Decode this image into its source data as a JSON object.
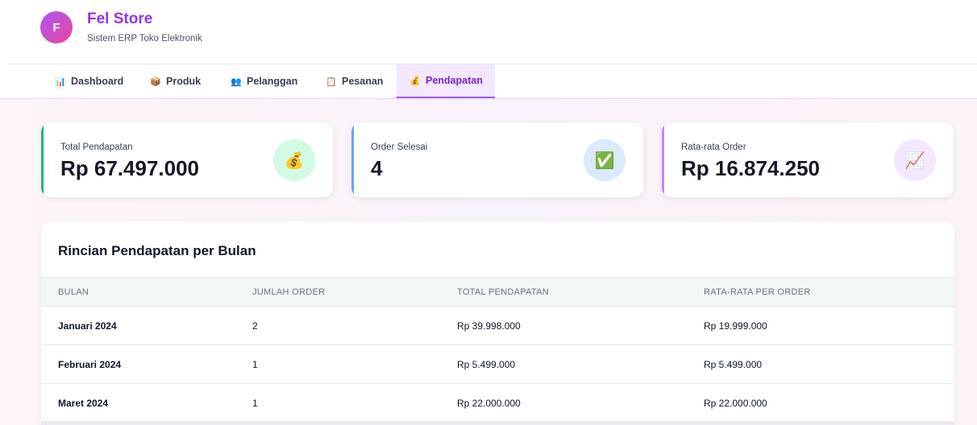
{
  "brand": {
    "initial": "F",
    "name": "Fel Store",
    "subtitle": "Sistem ERP Toko Elektronik"
  },
  "nav": {
    "items": [
      {
        "label": "Dashboard",
        "icon": "bar-chart-icon",
        "glyph": "📊"
      },
      {
        "label": "Produk",
        "icon": "box-icon",
        "glyph": "📦"
      },
      {
        "label": "Pelanggan",
        "icon": "users-icon",
        "glyph": "👥"
      },
      {
        "label": "Pesanan",
        "icon": "clipboard-icon",
        "glyph": "📋"
      },
      {
        "label": "Pendapatan",
        "icon": "money-bag-icon",
        "glyph": "💰"
      }
    ],
    "active_index": 4
  },
  "stats": [
    {
      "label": "Total Pendapatan",
      "value": "Rp 67.497.000",
      "icon": "money-bag-icon",
      "glyph": "💰",
      "accent": "#10b981",
      "icon_bg": "#d1fae5"
    },
    {
      "label": "Order Selesai",
      "value": "4",
      "icon": "check-box-icon",
      "glyph": "✅",
      "accent": "#60a5fa",
      "icon_bg": "#dbeafe"
    },
    {
      "label": "Rata-rata Order",
      "value": "Rp 16.874.250",
      "icon": "trend-chart-icon",
      "glyph": "📈",
      "accent": "#c084fc",
      "icon_bg": "#f3e8ff"
    }
  ],
  "table": {
    "title": "Rincian Pendapatan per Bulan",
    "headers": [
      "BULAN",
      "JUMLAH ORDER",
      "TOTAL PENDAPATAN",
      "RATA-RATA PER ORDER"
    ],
    "rows": [
      [
        "Januari 2024",
        "2",
        "Rp 39.998.000",
        "Rp 19.999.000"
      ],
      [
        "Februari 2024",
        "1",
        "Rp 5.499.000",
        "Rp 5.499.000"
      ],
      [
        "Maret 2024",
        "1",
        "Rp 22.000.000",
        "Rp 22.000.000"
      ]
    ]
  }
}
